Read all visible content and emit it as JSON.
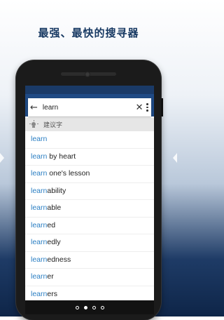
{
  "headline": "最强、最快的搜寻器",
  "search": {
    "value": "learn",
    "back_icon": "arrow-left-icon",
    "clear_icon": "close-icon",
    "menu_icon": "more-vert-icon"
  },
  "suggestions": {
    "title": "建议字",
    "icon": "lightbulb-icon",
    "items": [
      {
        "match": "learn",
        "rest": ""
      },
      {
        "match": "learn",
        "rest": " by heart"
      },
      {
        "match": "learn",
        "rest": " one's lesson"
      },
      {
        "match": "learn",
        "rest": "ability"
      },
      {
        "match": "learn",
        "rest": "able"
      },
      {
        "match": "learn",
        "rest": "ed"
      },
      {
        "match": "learn",
        "rest": "edly"
      },
      {
        "match": "learn",
        "rest": "edness"
      },
      {
        "match": "learn",
        "rest": "er"
      },
      {
        "match": "learn",
        "rest": "ers"
      }
    ]
  },
  "pager": {
    "count": 4,
    "active_index": 1
  },
  "colors": {
    "appbar": "#1f4a85",
    "match_highlight": "#2b7fc3",
    "headline": "#183a63"
  }
}
